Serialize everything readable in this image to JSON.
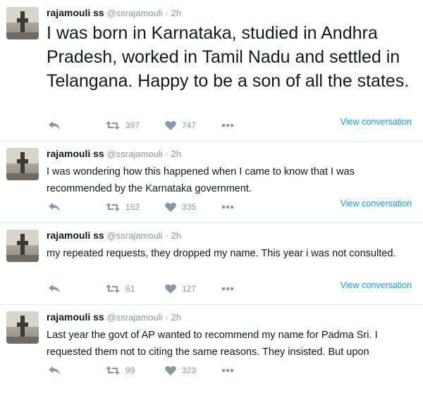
{
  "tweets": [
    {
      "name": "rajamouli ss",
      "handle": "@ssrajamouli",
      "dot": "·",
      "time": "2h",
      "text": "I was born in Karnataka, studied in Andhra Pradesh, worked in Tamil Nadu and settled in Telangana. Happy to be a son of all the states.",
      "retweets": "397",
      "likes": "747",
      "view_conversation": "View conversation"
    },
    {
      "name": "rajamouli ss",
      "handle": "@ssrajamouli",
      "dot": "·",
      "time": "2h",
      "text": "I was wondering how this happened when I came to know that I was recommended by the Karnataka government.",
      "retweets": "152",
      "likes": "335",
      "view_conversation": "View conversation"
    },
    {
      "name": "rajamouli ss",
      "handle": "@ssrajamouli",
      "dot": "·",
      "time": "2h",
      "text": "my repeated requests, they dropped my name. This year i was not consulted.",
      "retweets": "61",
      "likes": "127",
      "view_conversation": "View conversation"
    },
    {
      "name": "rajamouli ss",
      "handle": "@ssrajamouli",
      "dot": "·",
      "time": "2h",
      "text": "Last year the govt of AP wanted to recommend my name for Padma Sri. I requested them not to citing the same reasons. They insisted. But upon",
      "retweets": "99",
      "likes": "323"
    }
  ],
  "icons": {
    "reply": "reply-icon",
    "retweet": "retweet-icon",
    "like": "heart-icon",
    "more": "more-icon"
  },
  "colors": {
    "icon_gray": "#8899a6",
    "link_blue": "#1b95e0",
    "text": "#14171a",
    "divider": "#e1e8ed"
  }
}
